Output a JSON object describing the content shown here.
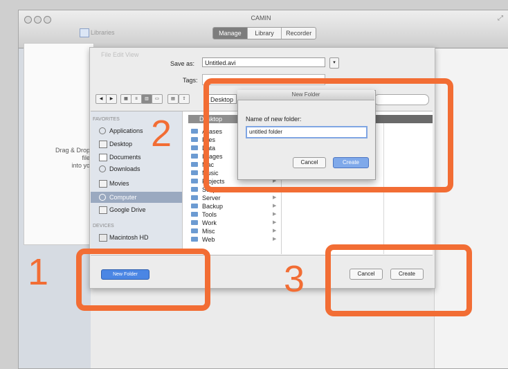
{
  "window": {
    "title": "CAMIN",
    "toolbar_label": "Libraries",
    "segments": [
      "Manage",
      "Library",
      "Recorder"
    ],
    "behind_text_line1": "Drag & Drop file",
    "behind_text_line2": "into yo"
  },
  "save_sheet": {
    "faded_menu": "File   Edit   View",
    "save_as_label": "Save as:",
    "save_as_value": "Untitled.avi",
    "tags_label": "Tags:",
    "path_value": "Desktop",
    "favorites_header": "FAVORITES",
    "devices_header": "DEVICES",
    "sidebar_items": [
      {
        "label": "Applications"
      },
      {
        "label": "Desktop"
      },
      {
        "label": "Documents"
      },
      {
        "label": "Downloads"
      },
      {
        "label": "Movies"
      },
      {
        "label": "Computer"
      },
      {
        "label": "Google Drive"
      }
    ],
    "device_item": "Macintosh HD",
    "column_header": "Desktop",
    "folders": [
      "Aliases",
      "Files",
      "Data",
      "Images",
      "Mac",
      "Music",
      "Projects",
      "Scripts",
      "Server",
      "Backup",
      "Tools",
      "Work",
      "Misc",
      "Web"
    ],
    "new_folder_button": "New Folder",
    "cancel_button": "Cancel",
    "create_button": "Create"
  },
  "new_folder_dialog": {
    "title": "New Folder",
    "name_label": "Name of new folder:",
    "name_value": "untitled folder",
    "cancel_button": "Cancel",
    "create_button": "Create"
  },
  "annotations": {
    "label_1": "1",
    "label_2": "2",
    "label_3": "3",
    "color": "#f26d34"
  }
}
